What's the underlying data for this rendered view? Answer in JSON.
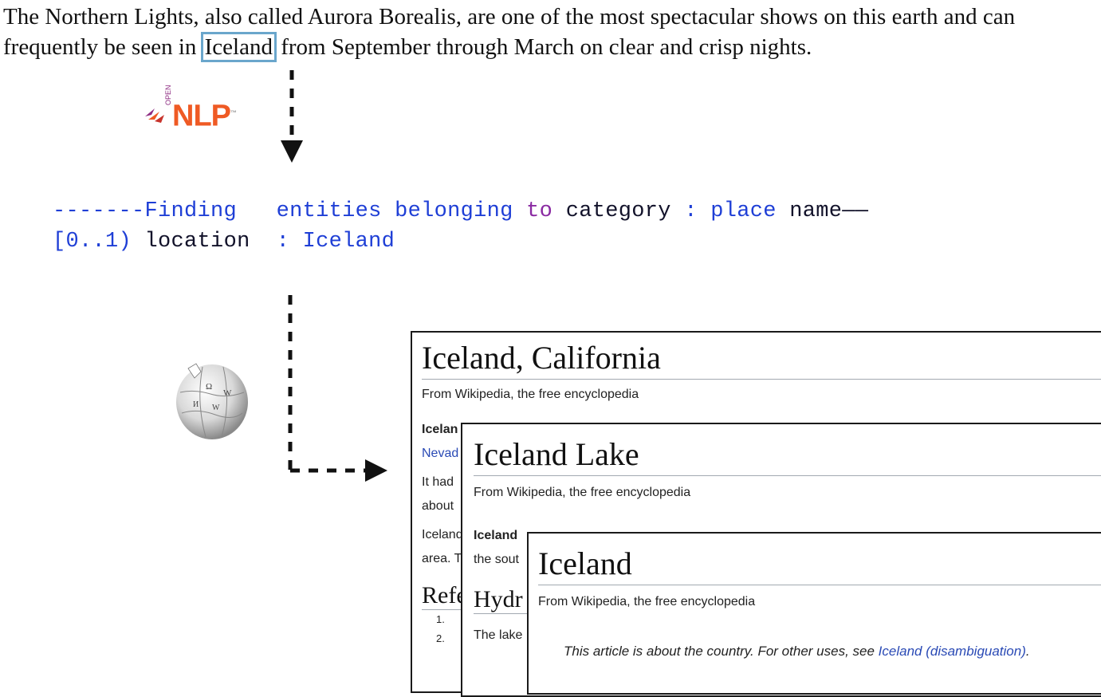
{
  "intro": {
    "before": "The Northern Lights, also called Aurora Borealis, are one of the most spectacular shows on this earth and can frequently be seen in",
    "highlight": "Iceland",
    "after": "from September through March on clear and crisp nights."
  },
  "logo": {
    "nlp": "NLP",
    "open": "OPEN",
    "tm": "™"
  },
  "code": {
    "line1": {
      "dashes": "-------",
      "finding": "Finding",
      "entities": "entities belonging",
      "to": "to",
      "category": "category",
      "colon": ":",
      "place": "place",
      "name": "name——"
    },
    "line2": {
      "range": "[0..1)",
      "location": "location",
      "colon": ":",
      "value": "Iceland"
    }
  },
  "cards": {
    "card1": {
      "title": "Iceland, California",
      "subtitle": "From Wikipedia, the free encyclopedia",
      "lines": [
        "Icelan",
        "Nevad",
        "It had",
        "about",
        "Iceland",
        "area. T"
      ],
      "h2": "Refe",
      "list": [
        "1.",
        "2."
      ]
    },
    "card2": {
      "title": "Iceland Lake",
      "subtitle": "From Wikipedia, the free encyclopedia",
      "lines": [
        "Iceland",
        "the sout"
      ],
      "h2": "Hydr",
      "body": "The lake"
    },
    "card3": {
      "title": "Iceland",
      "subtitle": "From Wikipedia, the free encyclopedia",
      "note_prefix": "This article is about the country. For other uses, see",
      "note_link": "Iceland (disambiguation)",
      "note_suffix": "."
    }
  },
  "icons": [
    "opennlp-logo-icon",
    "wikipedia-globe-icon",
    "dashed-arrow-down-icon",
    "dashed-arrow-right-icon"
  ],
  "colors": {
    "highlight_border": "#6aa6cc",
    "code_blue": "#1f3fd6",
    "code_purple": "#8a2aa2",
    "nlp_orange": "#ef5a24",
    "wiki_link": "#2a4ab5"
  }
}
